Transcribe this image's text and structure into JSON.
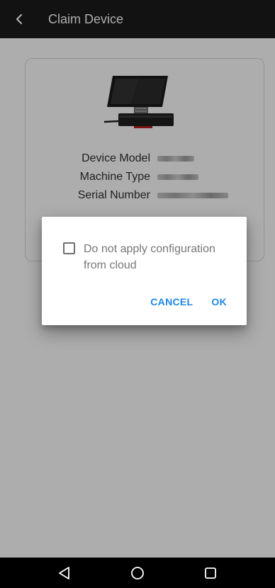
{
  "appbar": {
    "title": "Claim Device",
    "back_icon": "back-chevron-icon"
  },
  "device_card": {
    "image": "device-icon",
    "rows": [
      {
        "label": "Device Model"
      },
      {
        "label": "Machine Type"
      },
      {
        "label": "Serial Number"
      }
    ]
  },
  "dialog": {
    "checkbox_label": "Do not apply configuration from cloud",
    "checkbox_checked": false,
    "cancel_label": "CANCEL",
    "ok_label": "OK",
    "accent_color": "#1e88e5"
  },
  "navbar": {
    "back_icon": "nav-back-icon",
    "home_icon": "nav-home-icon",
    "recents_icon": "nav-recents-icon"
  }
}
